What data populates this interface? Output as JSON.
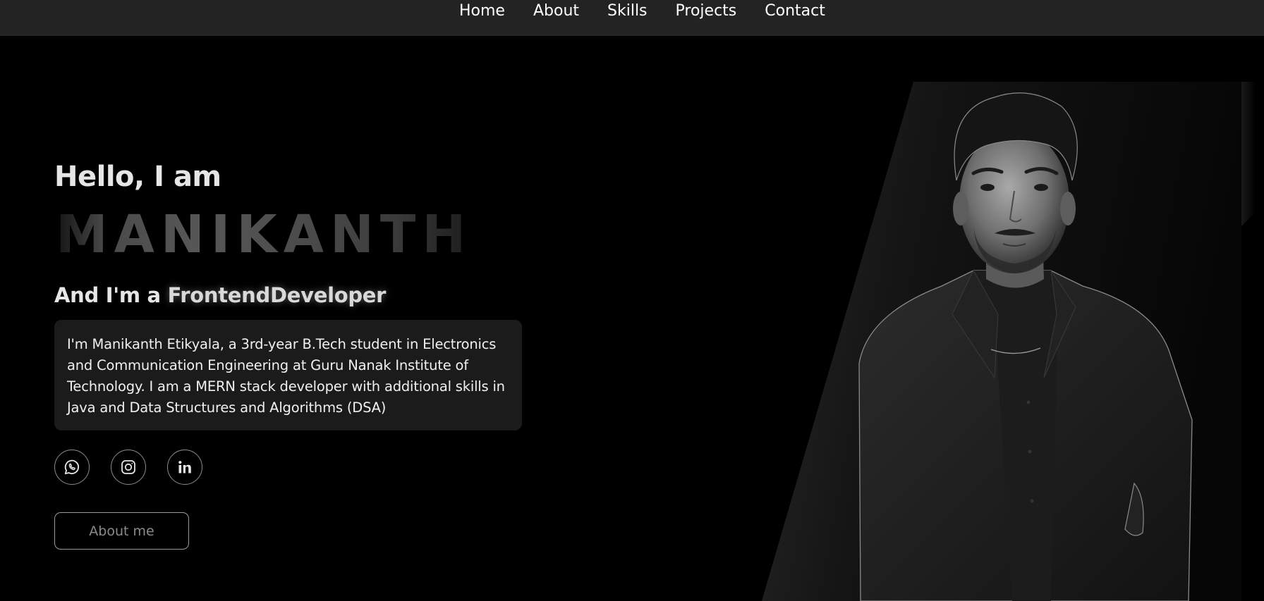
{
  "nav": {
    "items": [
      "Home",
      "About",
      "Skills",
      "Projects",
      "Contact"
    ]
  },
  "hero": {
    "greeting": "Hello, I am",
    "name": "MANIKANTH",
    "role_prefix": "And I'm a ",
    "role": "FrontendDeveloper",
    "bio": "I'm Manikanth Etikyala, a 3rd-year B.Tech student in Electronics and Communication Engineering at Guru Nanak Institute of Technology. I am a MERN stack developer with additional skills in Java and Data Structures and Algorithms (DSA)",
    "about_button": "About me"
  },
  "social": [
    {
      "icon": "whatsapp-icon"
    },
    {
      "icon": "instagram-icon"
    },
    {
      "icon": "linkedin-icon"
    }
  ],
  "colors": {
    "background": "#000000",
    "navbar": "#232323",
    "card": "#1b1b1b",
    "text": "#ffffff",
    "muted": "#8a8a8a"
  }
}
